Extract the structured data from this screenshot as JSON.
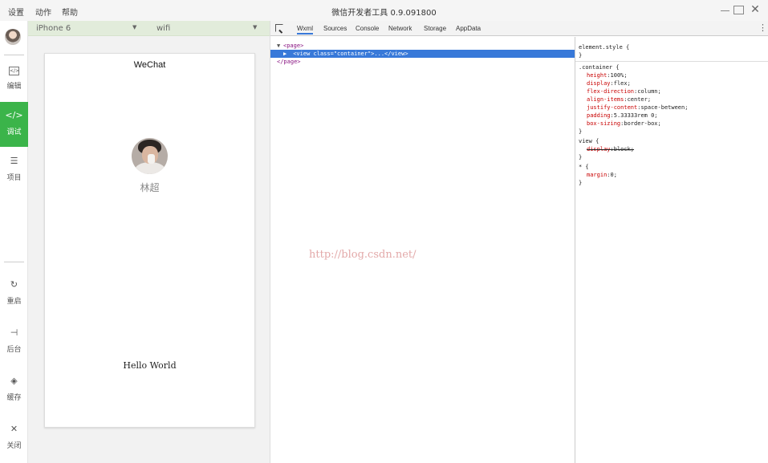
{
  "title_bar": {
    "menus": [
      "设置",
      "动作",
      "帮助"
    ],
    "title": "微信开发者工具 0.9.091800"
  },
  "sidebar": {
    "items": [
      {
        "label": "编辑",
        "icon": "code-window-icon"
      },
      {
        "label": "调试",
        "icon": "debug-icon",
        "active": true
      },
      {
        "label": "项目",
        "icon": "menu-list-icon"
      },
      {
        "label": "重启",
        "icon": "restart-icon"
      },
      {
        "label": "后台",
        "icon": "background-icon"
      },
      {
        "label": "缓存",
        "icon": "cache-layers-icon"
      },
      {
        "label": "关闭",
        "icon": "close-icon"
      }
    ]
  },
  "simulator": {
    "device": "iPhone 6",
    "network": "wifi",
    "nav_title": "WeChat",
    "nickname": "林超",
    "hello": "Hello World"
  },
  "devtools": {
    "tabs": [
      "Wxml",
      "Sources",
      "Console",
      "Network",
      "Storage",
      "AppData"
    ],
    "active_tab": "Wxml",
    "tree": {
      "page_open": "<page>",
      "view_tag": "<view",
      "view_attr_name": "class=",
      "view_attr_value": "\"container\"",
      "view_rest": ">...</view>",
      "page_close": "</page>"
    },
    "watermark": "http://blog.csdn.net/",
    "styles": {
      "element_style": "element.style {",
      "close": "}",
      "container_selector": ".container {",
      "container_props": [
        {
          "name": "height",
          "value": "100%;"
        },
        {
          "name": "display",
          "value": "flex;"
        },
        {
          "name": "flex-direction",
          "value": "column;"
        },
        {
          "name": "align-items",
          "value": "center;"
        },
        {
          "name": "justify-content",
          "value": "space-between;"
        },
        {
          "name": "padding",
          "value": "5.33333rem 0;"
        },
        {
          "name": "box-sizing",
          "value": "border-box;"
        }
      ],
      "view_selector": "view {",
      "view_prop": {
        "name": "display",
        "value": "block;",
        "struck": true
      },
      "star_selector": "* {",
      "star_prop": {
        "name": "margin",
        "value": "0;"
      }
    }
  },
  "colors": {
    "active_green": "#3bb44a",
    "selection_blue": "#3879d9",
    "toolbar_green": "#e2ecdb"
  }
}
